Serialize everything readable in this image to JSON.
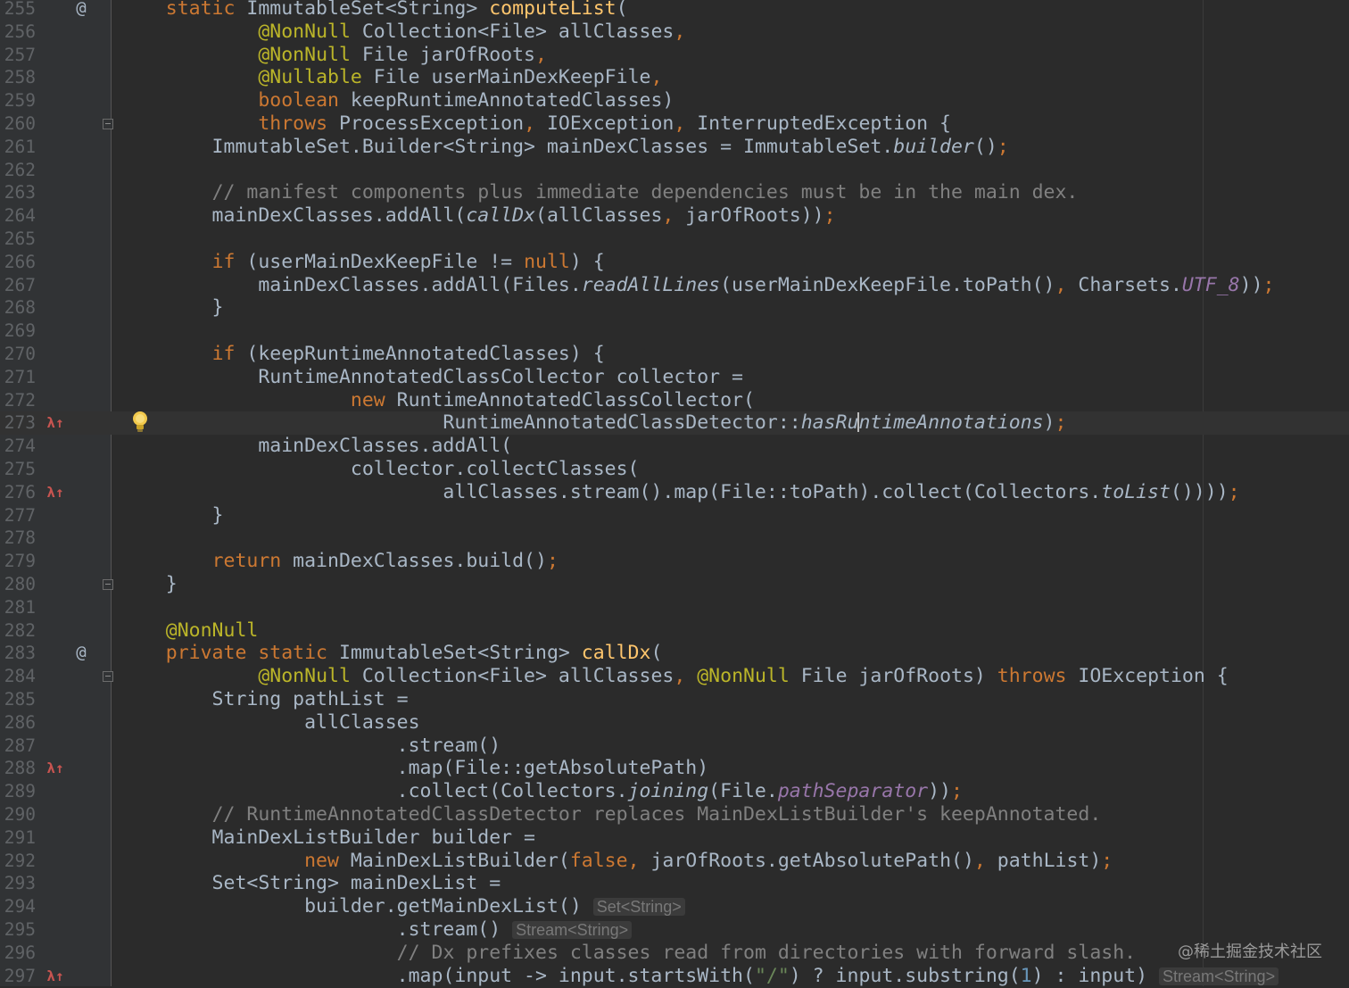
{
  "editor": {
    "language": "java",
    "theme_colors": {
      "background": "#2b2b2b",
      "gutter": "#313335",
      "keyword": "#cc7832",
      "annotation": "#bbb529",
      "method_decl": "#ffc66d",
      "static_field": "#9876aa",
      "comment": "#808080",
      "number": "#6897bb",
      "string": "#6a8759",
      "text": "#a9b7c6"
    },
    "lines": [
      {
        "n": "255",
        "g": "at",
        "t": [
          [
            "    "
          ],
          [
            "static ",
            "kw"
          ],
          [
            "ImmutableSet<String> "
          ],
          [
            "computeList",
            "fn"
          ],
          [
            "("
          ]
        ]
      },
      {
        "n": "256",
        "t": [
          [
            "            "
          ],
          [
            "@NonNull ",
            "an"
          ],
          [
            "Collection<File> allClasses"
          ],
          [
            ",",
            "kw"
          ]
        ]
      },
      {
        "n": "257",
        "t": [
          [
            "            "
          ],
          [
            "@NonNull ",
            "an"
          ],
          [
            "File jarOfRoots"
          ],
          [
            ",",
            "kw"
          ]
        ]
      },
      {
        "n": "258",
        "t": [
          [
            "            "
          ],
          [
            "@Nullable ",
            "an"
          ],
          [
            "File userMainDexKeepFile"
          ],
          [
            ",",
            "kw"
          ]
        ]
      },
      {
        "n": "259",
        "t": [
          [
            "            "
          ],
          [
            "boolean ",
            "kw"
          ],
          [
            "keepRuntimeAnnotatedClasses)"
          ]
        ]
      },
      {
        "n": "260",
        "f": true,
        "t": [
          [
            "            "
          ],
          [
            "throws ",
            "kw"
          ],
          [
            "ProcessException"
          ],
          [
            ", ",
            "kw"
          ],
          [
            "IOException"
          ],
          [
            ", ",
            "kw"
          ],
          [
            "InterruptedException {"
          ]
        ]
      },
      {
        "n": "261",
        "t": [
          [
            "        ImmutableSet.Builder<String> mainDexClasses = ImmutableSet."
          ],
          [
            "builder",
            "it"
          ],
          [
            "()"
          ],
          [
            ";",
            "kw"
          ]
        ]
      },
      {
        "n": "262",
        "t": []
      },
      {
        "n": "263",
        "t": [
          [
            "        "
          ],
          [
            "// manifest components plus immediate dependencies must be in the main dex.",
            "cm"
          ]
        ]
      },
      {
        "n": "264",
        "t": [
          [
            "        mainDexClasses.addAll("
          ],
          [
            "callDx",
            "it"
          ],
          [
            "(allClasses"
          ],
          [
            ", ",
            "kw"
          ],
          [
            "jarOfRoots))"
          ],
          [
            ";",
            "kw"
          ]
        ]
      },
      {
        "n": "265",
        "t": []
      },
      {
        "n": "266",
        "t": [
          [
            "        "
          ],
          [
            "if ",
            "kw"
          ],
          [
            "(userMainDexKeepFile != "
          ],
          [
            "null",
            "kw"
          ],
          [
            ") {"
          ]
        ]
      },
      {
        "n": "267",
        "t": [
          [
            "            mainDexClasses.addAll(Files."
          ],
          [
            "readAllLines",
            "it"
          ],
          [
            "(userMainDexKeepFile.toPath()"
          ],
          [
            ", ",
            "kw"
          ],
          [
            "Charsets."
          ],
          [
            "UTF_8",
            "st"
          ],
          [
            "))"
          ],
          [
            ";",
            "kw"
          ]
        ]
      },
      {
        "n": "268",
        "t": [
          [
            "        }"
          ]
        ]
      },
      {
        "n": "269",
        "t": []
      },
      {
        "n": "270",
        "t": [
          [
            "        "
          ],
          [
            "if ",
            "kw"
          ],
          [
            "(keepRuntimeAnnotatedClasses) {"
          ]
        ]
      },
      {
        "n": "271",
        "t": [
          [
            "            RuntimeAnnotatedClassCollector collector ="
          ]
        ]
      },
      {
        "n": "272",
        "t": [
          [
            "                    "
          ],
          [
            "new ",
            "kw"
          ],
          [
            "RuntimeAnnotatedClassCollector("
          ]
        ]
      },
      {
        "n": "273",
        "g": "lambda",
        "bulb": true,
        "cur": true,
        "t": [
          [
            "                            RuntimeAnnotatedClassDetector::"
          ],
          [
            "hasRu",
            "it"
          ],
          [
            "|",
            "caret"
          ],
          [
            "ntimeAnnotations",
            "it"
          ],
          [
            ")"
          ],
          [
            ";",
            "kw"
          ]
        ]
      },
      {
        "n": "274",
        "t": [
          [
            "            mainDexClasses.addAll("
          ]
        ]
      },
      {
        "n": "275",
        "t": [
          [
            "                    collector.collectClasses("
          ]
        ]
      },
      {
        "n": "276",
        "g": "lambda",
        "t": [
          [
            "                            allClasses.stream().map(File::toPath).collect(Collectors."
          ],
          [
            "toList",
            "it"
          ],
          [
            "())))"
          ],
          [
            ";",
            "kw"
          ]
        ]
      },
      {
        "n": "277",
        "t": [
          [
            "        }"
          ]
        ]
      },
      {
        "n": "278",
        "t": []
      },
      {
        "n": "279",
        "t": [
          [
            "        "
          ],
          [
            "return ",
            "kw"
          ],
          [
            "mainDexClasses.build()"
          ],
          [
            ";",
            "kw"
          ]
        ]
      },
      {
        "n": "280",
        "f": true,
        "t": [
          [
            "    }"
          ]
        ]
      },
      {
        "n": "281",
        "t": []
      },
      {
        "n": "282",
        "t": [
          [
            "    "
          ],
          [
            "@NonNull",
            "an"
          ]
        ]
      },
      {
        "n": "283",
        "g": "at",
        "t": [
          [
            "    "
          ],
          [
            "private static ",
            "kw"
          ],
          [
            "ImmutableSet<String> "
          ],
          [
            "callDx",
            "fn"
          ],
          [
            "("
          ]
        ]
      },
      {
        "n": "284",
        "f": true,
        "t": [
          [
            "            "
          ],
          [
            "@NonNull ",
            "an"
          ],
          [
            "Collection<File> allClasses"
          ],
          [
            ", ",
            "kw"
          ],
          [
            "@NonNull ",
            "an"
          ],
          [
            "File jarOfRoots) "
          ],
          [
            "throws ",
            "kw"
          ],
          [
            "IOException {"
          ]
        ]
      },
      {
        "n": "285",
        "t": [
          [
            "        String pathList ="
          ]
        ]
      },
      {
        "n": "286",
        "t": [
          [
            "                allClasses"
          ]
        ]
      },
      {
        "n": "287",
        "t": [
          [
            "                        .stream()"
          ]
        ]
      },
      {
        "n": "288",
        "g": "lambda",
        "t": [
          [
            "                        .map(File::getAbsolutePath)"
          ]
        ]
      },
      {
        "n": "289",
        "t": [
          [
            "                        .collect(Collectors."
          ],
          [
            "joining",
            "it"
          ],
          [
            "(File."
          ],
          [
            "pathSeparator",
            "st"
          ],
          [
            "))"
          ],
          [
            ";",
            "kw"
          ]
        ]
      },
      {
        "n": "290",
        "t": [
          [
            "        "
          ],
          [
            "// RuntimeAnnotatedClassDetector replaces MainDexListBuilder's keepAnnotated.",
            "cm"
          ]
        ]
      },
      {
        "n": "291",
        "t": [
          [
            "        MainDexListBuilder builder ="
          ]
        ]
      },
      {
        "n": "292",
        "t": [
          [
            "                "
          ],
          [
            "new ",
            "kw"
          ],
          [
            "MainDexListBuilder("
          ],
          [
            "false",
            "kw"
          ],
          [
            ", ",
            "kw"
          ],
          [
            "jarOfRoots.getAbsolutePath()"
          ],
          [
            ", ",
            "kw"
          ],
          [
            "pathList)"
          ],
          [
            ";",
            "kw"
          ]
        ]
      },
      {
        "n": "293",
        "t": [
          [
            "        Set<String> mainDexList ="
          ]
        ]
      },
      {
        "n": "294",
        "t": [
          [
            "                builder.getMainDexList() "
          ],
          [
            "Set<String>",
            "hint"
          ]
        ]
      },
      {
        "n": "295",
        "t": [
          [
            "                        .stream() "
          ],
          [
            "Stream<String>",
            "hint"
          ]
        ]
      },
      {
        "n": "296",
        "t": [
          [
            "                        "
          ],
          [
            "// Dx prefixes classes read from directories with forward slash.",
            "cm"
          ]
        ]
      },
      {
        "n": "297",
        "g": "lambda",
        "t": [
          [
            "                        .map(input -> input.startsWith("
          ],
          [
            "\"/\"",
            "strl"
          ],
          [
            ") ? input.substring("
          ],
          [
            "1",
            "nm"
          ],
          [
            ") : input) "
          ],
          [
            "Stream<String>",
            "hint"
          ]
        ]
      }
    ]
  },
  "watermark": "@稀土掘金技术社区",
  "icons": {
    "at": "implements-at-icon",
    "lambda": "lambda-icon",
    "bulb": "intention-bulb-icon",
    "fold": "fold-marker-icon"
  }
}
